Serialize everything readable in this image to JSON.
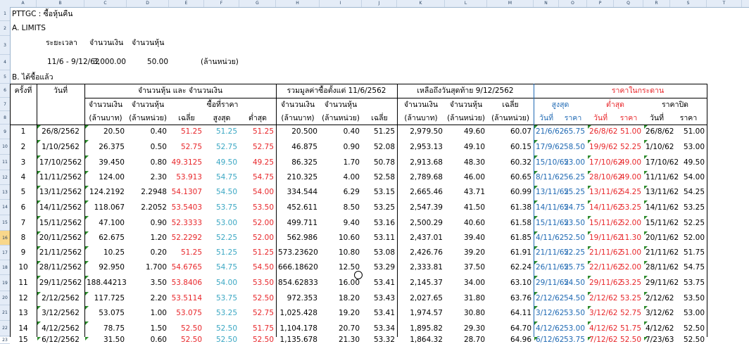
{
  "columns": [
    "A",
    "B",
    "C",
    "D",
    "E",
    "F",
    "G",
    "H",
    "I",
    "J",
    "K",
    "L",
    "M",
    "N",
    "O",
    "P",
    "Q",
    "R",
    "S",
    "T"
  ],
  "row_numbers": [
    "1",
    "2",
    "3",
    "4",
    "5",
    "6",
    "7",
    "8",
    "9",
    "10",
    "11",
    "12",
    "13",
    "14",
    "15",
    "16",
    "17",
    "18",
    "19",
    "20",
    "21",
    "22",
    "23"
  ],
  "selected_row": "16",
  "title": "PTTGC : ซื้อหุ้นคืน",
  "section_a": "A.  LIMITS",
  "limits": {
    "period_label": "ระยะเวลา",
    "amount_label": "จำนวนเงิน",
    "shares_label": "จำนวนหุ้น",
    "period_value": "11/6 - 9/12/62",
    "amount_value": "3,000.00",
    "shares_value": "50.00",
    "unit_note": "(ล้านหน่วย)"
  },
  "section_b": "B.  ได้ซื้อแล้ว",
  "headers": {
    "no": "ครั้งที่",
    "date": "วันที่",
    "group1": "จำนวนหุ้น และ จำนวนเงิน",
    "group2": "รวมมูลค่าซื้อตั้งแต่ 11/6/2562",
    "group3": "เหลือถึงวันสุดท้าย 9/12/2562",
    "group4": "ราคาในกระดาน",
    "amount": "จำนวนเงิน",
    "shares": "จำนวนหุ้น",
    "buy_price": "ซื้อที่ราคา",
    "average": "เฉลี่ย",
    "highest": "สูงสุด",
    "lowest": "ต่ำสุด",
    "close": "ราคาปิด",
    "mb": "(ล้านบาท)",
    "mu": "(ล้านหน่วย)",
    "avg2": "เฉลี่ย",
    "day": "วันที่",
    "price": "ราคา",
    "price_typo": "ราคา"
  },
  "rows": [
    [
      "1",
      "26/8/2562",
      "20.50",
      "0.40",
      "51.25",
      "51.25",
      "51.25",
      "20.500",
      "0.40",
      "51.25",
      "2,979.50",
      "49.60",
      "60.07",
      "21/6/62",
      "65.75",
      "26/8/62",
      "51.00",
      "26/8/62",
      "51.00"
    ],
    [
      "2",
      "1/10/2562",
      "26.375",
      "0.50",
      "52.75",
      "52.75",
      "52.75",
      "46.875",
      "0.90",
      "52.08",
      "2,953.13",
      "49.10",
      "60.15",
      "17/9/62",
      "58.50",
      "19/9/62",
      "52.25",
      "1/10/62",
      "53.00"
    ],
    [
      "3",
      "17/10/2562",
      "39.450",
      "0.80",
      "49.3125",
      "49.50",
      "49.25",
      "86.325",
      "1.70",
      "50.78",
      "2,913.68",
      "48.30",
      "60.32",
      "15/10/62",
      "53.00",
      "17/10/62",
      "49.00",
      "17/10/62",
      "49.50"
    ],
    [
      "4",
      "11/11/2562",
      "124.00",
      "2.30",
      "53.913",
      "54.75",
      "54.75",
      "210.325",
      "4.00",
      "52.58",
      "2,789.68",
      "46.00",
      "60.65",
      "8/11/62",
      "56.25",
      "28/10/62",
      "49.00",
      "11/11/62",
      "54.00"
    ],
    [
      "5",
      "13/11/2562",
      "124.2192",
      "2.2948",
      "54.1307",
      "54.50",
      "54.00",
      "334.544",
      "6.29",
      "53.15",
      "2,665.46",
      "43.71",
      "60.99",
      "13/11/62",
      "55.25",
      "13/11/62",
      "54.25",
      "13/11/62",
      "54.25"
    ],
    [
      "6",
      "14/11/2562",
      "118.067",
      "2.2052",
      "53.5403",
      "53.75",
      "53.50",
      "452.611",
      "8.50",
      "53.25",
      "2,547.39",
      "41.50",
      "61.38",
      "14/11/62",
      "54.75",
      "14/11/62",
      "53.25",
      "14/11/62",
      "53.25"
    ],
    [
      "7",
      "15/11/2562",
      "47.100",
      "0.90",
      "52.3333",
      "53.00",
      "52.00",
      "499.711",
      "9.40",
      "53.16",
      "2,500.29",
      "40.60",
      "61.58",
      "15/11/62",
      "53.50",
      "15/11/62",
      "52.00",
      "15/11/62",
      "52.25"
    ],
    [
      "8",
      "20/11/2562",
      "62.675",
      "1.20",
      "52.2292",
      "52.25",
      "52.00",
      "562.986",
      "10.60",
      "53.11",
      "2,437.01",
      "39.40",
      "61.85",
      "4/11/62",
      "52.50",
      "19/11/62",
      "11.30",
      "20/11/62",
      "52.00"
    ],
    [
      "9",
      "21/11/2562",
      "10.25",
      "0.20",
      "51.25",
      "51.25",
      "51.25",
      "573.23620",
      "10.80",
      "53.08",
      "2,426.76",
      "39.20",
      "61.91",
      "21/11/62",
      "52.25",
      "21/11/62",
      "51.00",
      "21/11/62",
      "51.75"
    ],
    [
      "10",
      "28/11/2562",
      "92.950",
      "1.700",
      "54.6765",
      "54.75",
      "54.50",
      "666.18620",
      "12.50",
      "53.29",
      "2,333.81",
      "37.50",
      "62.24",
      "26/11/62",
      "55.75",
      "22/11/62",
      "52.00",
      "28/11/62",
      "54.75"
    ],
    [
      "11",
      "29/11/2562",
      "188.44213",
      "3.50",
      "53.8406",
      "54.00",
      "53.50",
      "854.62833",
      "16.00",
      "53.41",
      "2,145.37",
      "34.00",
      "63.10",
      "29/11/62",
      "54.50",
      "29/11/62",
      "53.25",
      "29/11/62",
      "53.75"
    ],
    [
      "12",
      "2/12/2562",
      "117.725",
      "2.20",
      "53.5114",
      "53.75",
      "52.50",
      "972.353",
      "18.20",
      "53.43",
      "2,027.65",
      "31.80",
      "63.76",
      "2/12/62",
      "54.50",
      "2/12/62",
      "53.25",
      "2/12/62",
      "53.50"
    ],
    [
      "13",
      "3/12/2562",
      "53.075",
      "1.00",
      "53.075",
      "53.25",
      "52.75",
      "1,025.428",
      "19.20",
      "53.41",
      "1,974.57",
      "30.80",
      "64.11",
      "3/12/62",
      "53.50",
      "3/12/62",
      "52.75",
      "3/12/62",
      "53.00"
    ],
    [
      "14",
      "4/12/2562",
      "78.75",
      "1.50",
      "52.50",
      "52.50",
      "51.75",
      "1,104.178",
      "20.70",
      "53.34",
      "1,895.82",
      "29.30",
      "64.70",
      "4/12/62",
      "53.00",
      "4/12/62",
      "51.75",
      "4/12/62",
      "52.50"
    ],
    [
      "15",
      "6/12/2562",
      "31.50",
      "0.60",
      "52.50",
      "52.50",
      "52.50",
      "1,135.678",
      "21.30",
      "53.32",
      "1,864.32",
      "28.70",
      "64.96",
      "6/12/62",
      "53.75",
      "7/12/62",
      "52.50",
      "7/23/63",
      "52.50"
    ]
  ],
  "colors": {
    "red": "#e8262a",
    "cyan": "#3aa7c3",
    "blue": "#1f69b3",
    "header_bg": "#e4ecf7"
  }
}
